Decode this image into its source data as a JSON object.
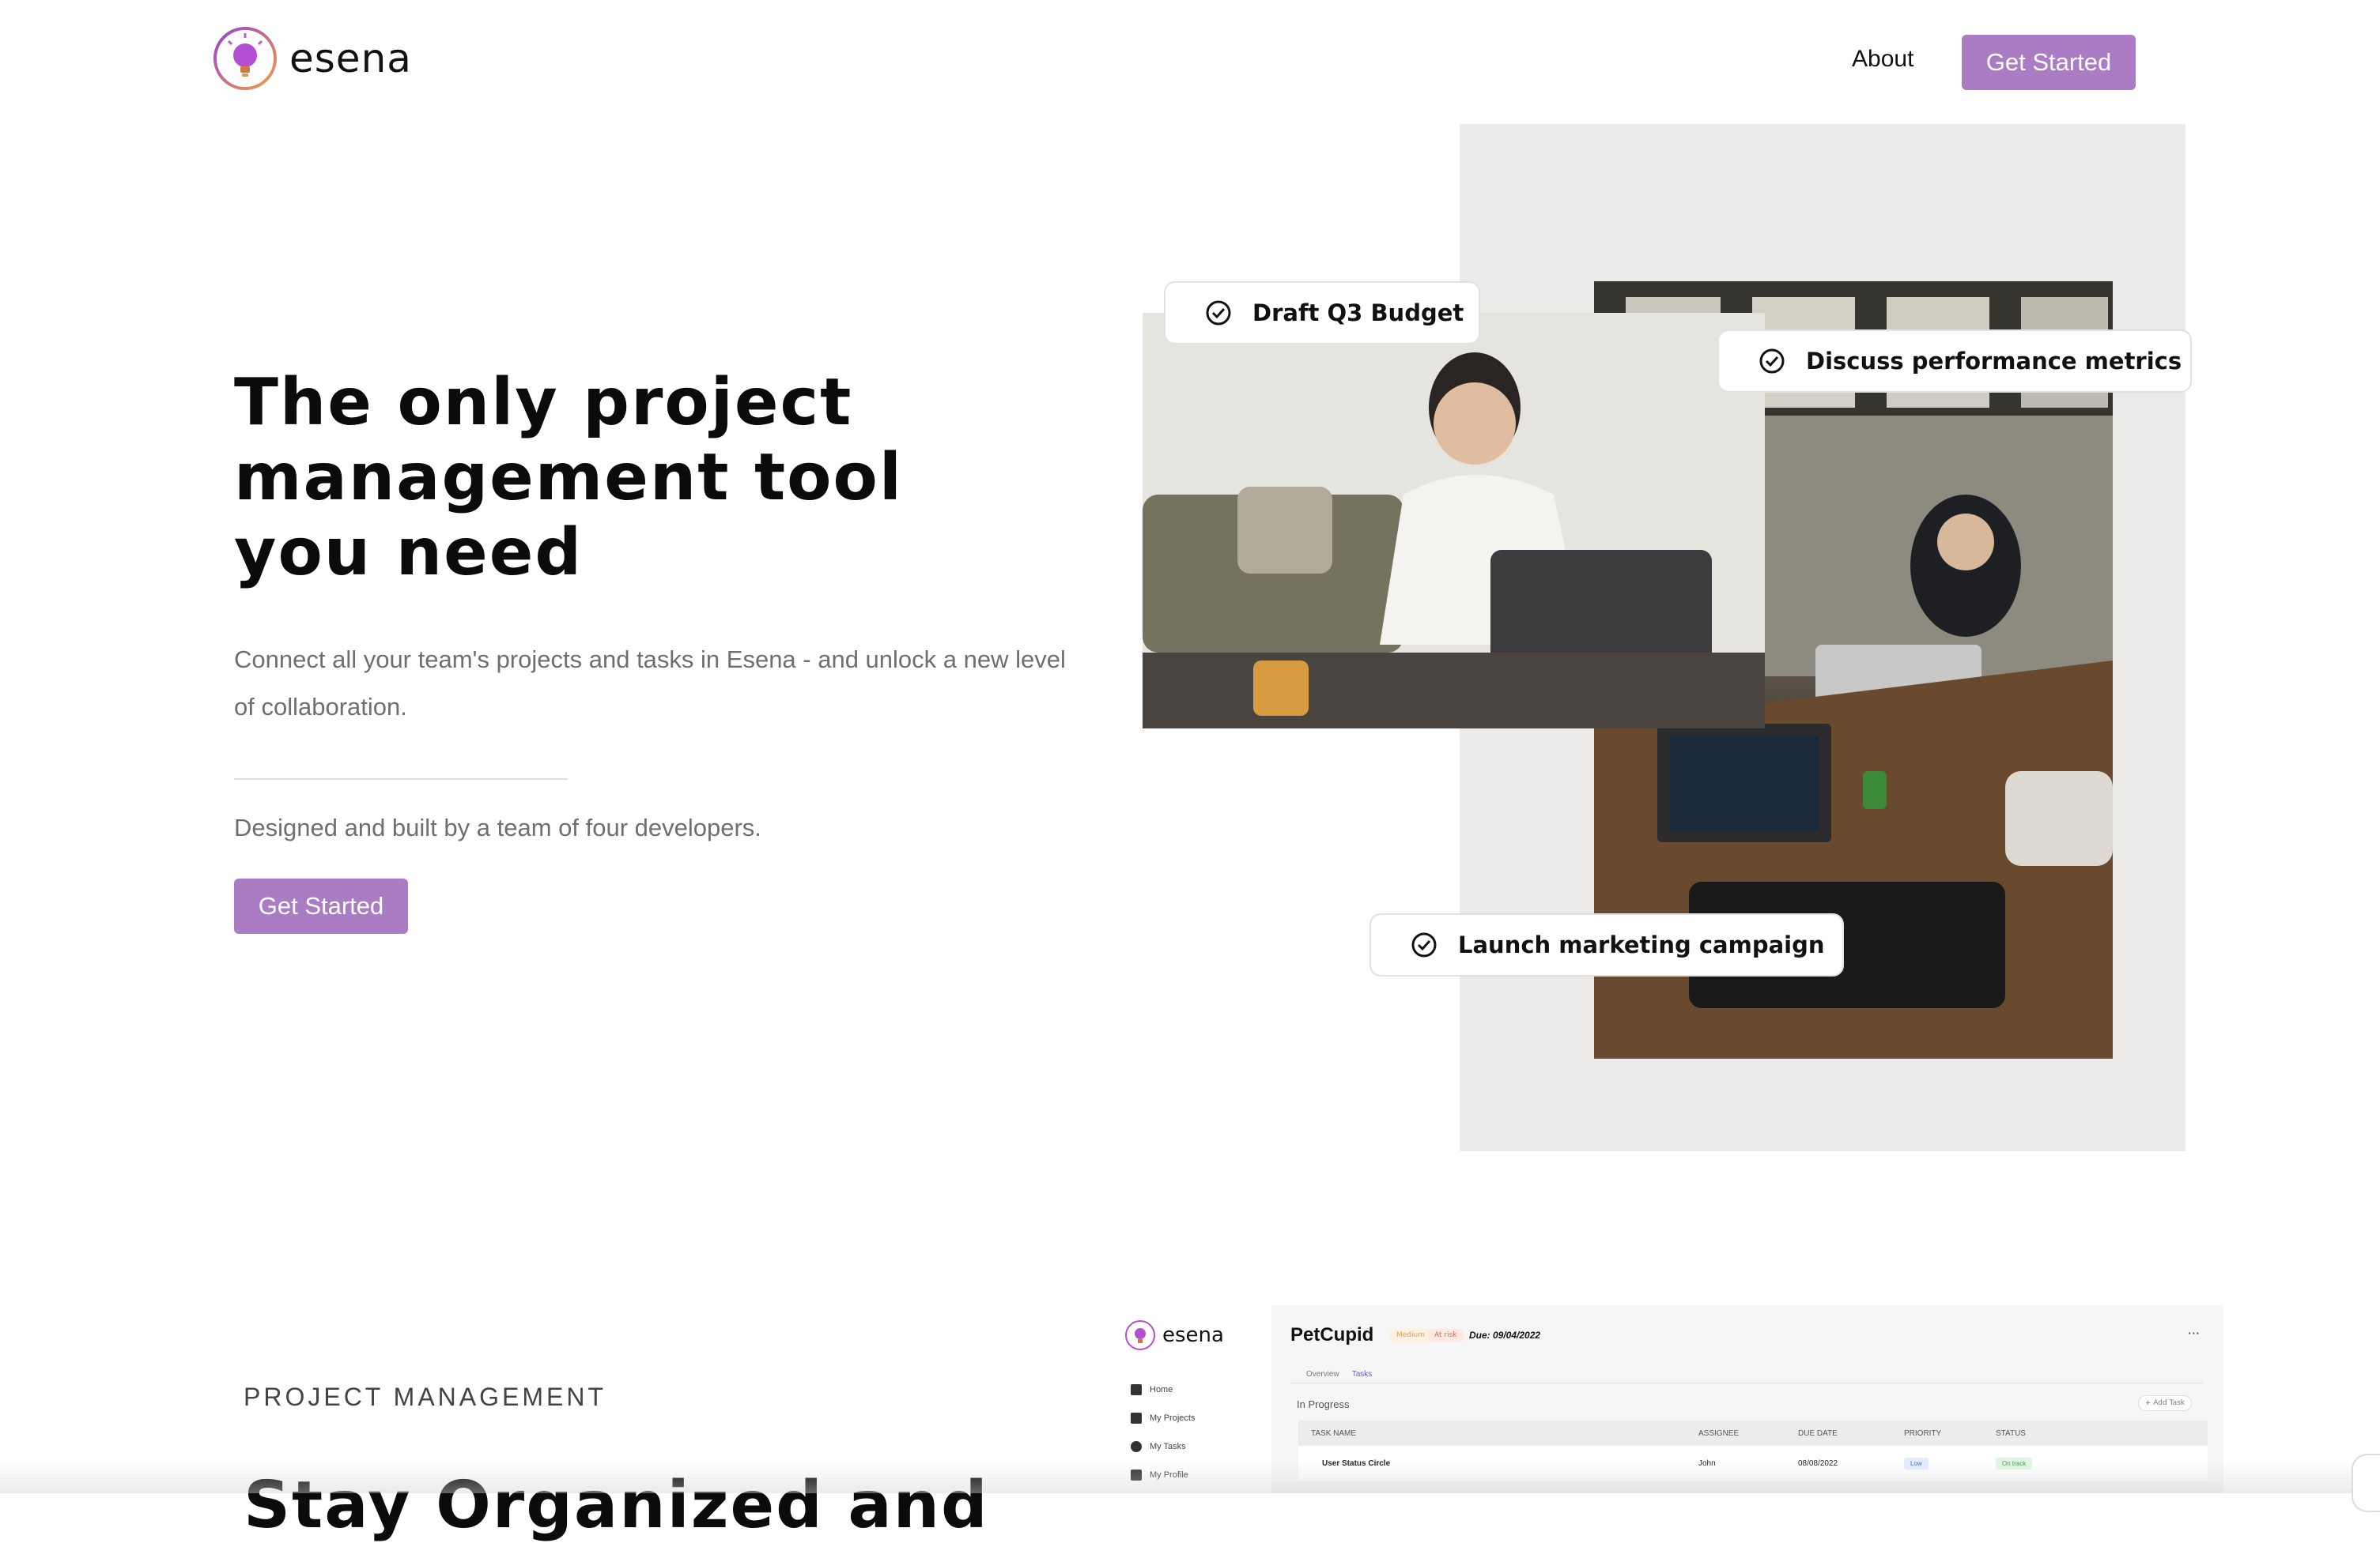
{
  "brand": {
    "name": "esena",
    "accent": "#a97cc4"
  },
  "nav": {
    "about_label": "About",
    "cta_label": "Get Started"
  },
  "hero": {
    "title": "The only project management tool you need",
    "description": "Connect all your team's projects and tasks in Esena - and unlock a new level of collaboration.",
    "credit": "Designed and built by a team of four developers.",
    "cta_label": "Get Started"
  },
  "tasks": [
    {
      "label": "Draft Q3 Budget",
      "icon": "check-circle-icon"
    },
    {
      "label": "Discuss performance metrics",
      "icon": "check-circle-icon"
    },
    {
      "label": "Launch marketing campaign",
      "icon": "check-circle-icon"
    }
  ],
  "section": {
    "eyebrow": "PROJECT MANAGEMENT",
    "title": "Stay Organized and"
  },
  "app_preview": {
    "brand": "esena",
    "sidebar": [
      {
        "label": "Home",
        "icon": "home-icon"
      },
      {
        "label": "My Projects",
        "icon": "projects-icon"
      },
      {
        "label": "My Tasks",
        "icon": "check-circle-icon"
      },
      {
        "label": "My Profile",
        "icon": "user-icon"
      }
    ],
    "project_title": "PetCupid",
    "tags": [
      "Medium",
      "At risk"
    ],
    "due": "Due: 09/04/2022",
    "more": "···",
    "tabs": [
      "Overview",
      "Tasks"
    ],
    "status_group": "In Progress",
    "add_task": "+ Add Task",
    "columns": [
      "TASK NAME",
      "ASSIGNEE",
      "DUE DATE",
      "PRIORITY",
      "STATUS"
    ],
    "rows": [
      {
        "task": "User Status Circle",
        "assignee": "John",
        "due": "08/08/2022",
        "priority": "Low",
        "status": "On track"
      }
    ]
  }
}
